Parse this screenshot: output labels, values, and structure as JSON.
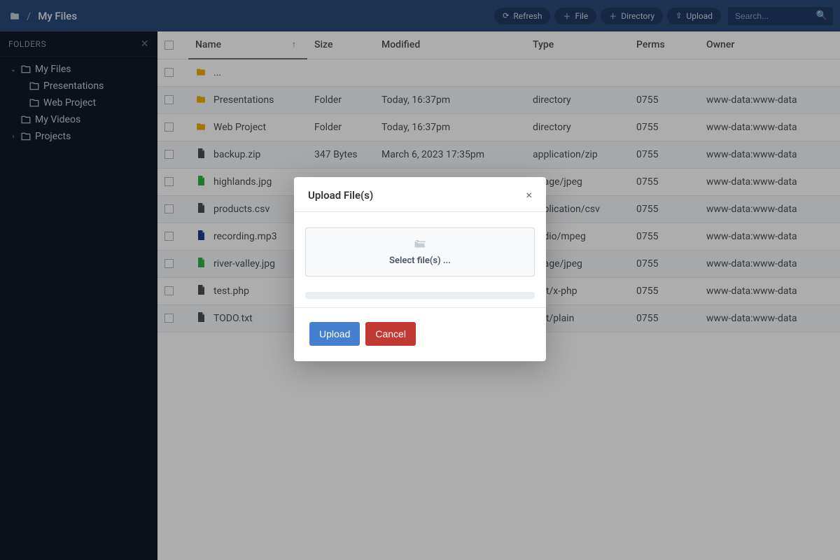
{
  "breadcrumb": {
    "root_icon": "folder",
    "current": "My Files"
  },
  "toolbar": {
    "refresh": "Refresh",
    "file": "File",
    "directory": "Directory",
    "upload": "Upload",
    "search_placeholder": "Search..."
  },
  "sidebar": {
    "heading": "FOLDERS",
    "tree": [
      {
        "label": "My Files",
        "depth": 0,
        "expanded": true
      },
      {
        "label": "Presentations",
        "depth": 1,
        "expanded": null
      },
      {
        "label": "Web Project",
        "depth": 1,
        "expanded": null
      },
      {
        "label": "My Videos",
        "depth": 0,
        "expanded": null
      },
      {
        "label": "Projects",
        "depth": 0,
        "expanded": false
      }
    ]
  },
  "table": {
    "headers": {
      "name": "Name",
      "size": "Size",
      "modified": "Modified",
      "type": "Type",
      "perms": "Perms",
      "owner": "Owner"
    },
    "sort_column": "name",
    "rows": [
      {
        "icon": "folder",
        "name": "...",
        "size": "",
        "modified": "",
        "type": "",
        "perms": "",
        "owner": ""
      },
      {
        "icon": "folder",
        "name": "Presentations",
        "size": "Folder",
        "modified": "Today, 16:37pm",
        "type": "directory",
        "perms": "0755",
        "owner": "www-data:www-data"
      },
      {
        "icon": "folder",
        "name": "Web Project",
        "size": "Folder",
        "modified": "Today, 16:37pm",
        "type": "directory",
        "perms": "0755",
        "owner": "www-data:www-data"
      },
      {
        "icon": "file-zip",
        "name": "backup.zip",
        "size": "347 Bytes",
        "modified": "March 6, 2023 17:35pm",
        "type": "application/zip",
        "perms": "0755",
        "owner": "www-data:www-data"
      },
      {
        "icon": "file-img",
        "name": "highlands.jpg",
        "size": "",
        "modified": "",
        "type": "image/jpeg",
        "perms": "0755",
        "owner": "www-data:www-data"
      },
      {
        "icon": "file-csv",
        "name": "products.csv",
        "size": "",
        "modified": "",
        "type": "application/csv",
        "perms": "0755",
        "owner": "www-data:www-data"
      },
      {
        "icon": "file-audio",
        "name": "recording.mp3",
        "size": "",
        "modified": "",
        "type": "audio/mpeg",
        "perms": "0755",
        "owner": "www-data:www-data"
      },
      {
        "icon": "file-img",
        "name": "river-valley.jpg",
        "size": "",
        "modified": "",
        "type": "image/jpeg",
        "perms": "0755",
        "owner": "www-data:www-data"
      },
      {
        "icon": "file-code",
        "name": "test.php",
        "size": "",
        "modified": "",
        "type": "text/x-php",
        "perms": "0755",
        "owner": "www-data:www-data"
      },
      {
        "icon": "file-txt",
        "name": "TODO.txt",
        "size": "",
        "modified": "",
        "type": "text/plain",
        "perms": "0755",
        "owner": "www-data:www-data"
      }
    ]
  },
  "modal": {
    "title": "Upload File(s)",
    "dropzone": "Select file(s) ...",
    "upload": "Upload",
    "cancel": "Cancel"
  }
}
